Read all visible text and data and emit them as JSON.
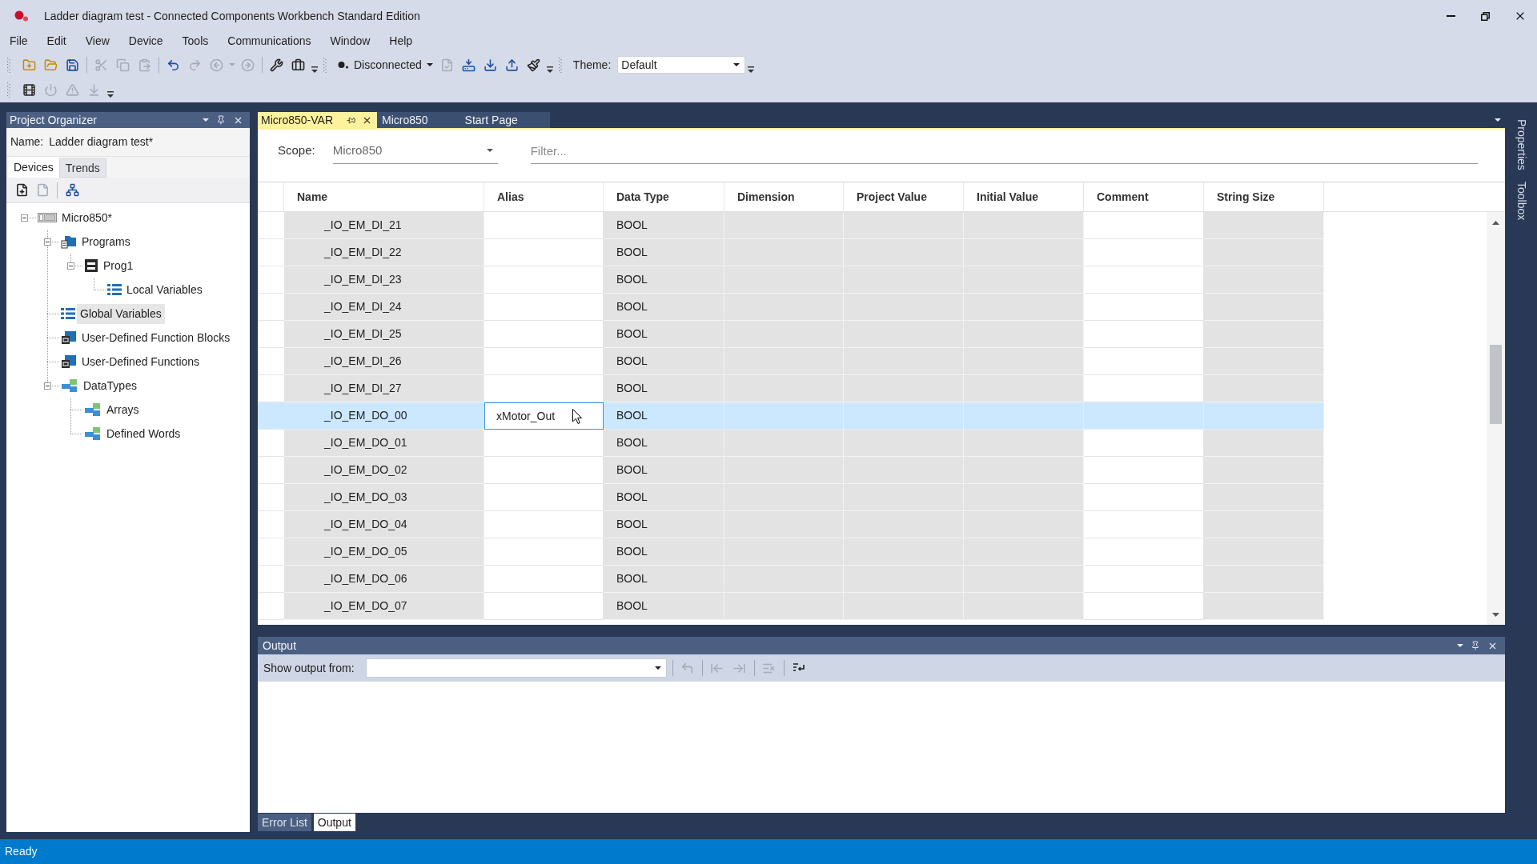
{
  "window": {
    "title": "Ladder diagram test - Connected Components Workbench Standard Edition"
  },
  "menu": [
    "File",
    "Edit",
    "View",
    "Device",
    "Tools",
    "Communications",
    "Window",
    "Help"
  ],
  "toolbar_rows": [
    {
      "groups": [
        {
          "items": [
            {
              "kind": "new",
              "disabled": false
            },
            {
              "kind": "open",
              "disabled": false
            },
            {
              "kind": "save",
              "disabled": false
            },
            {
              "kind": "separator"
            },
            {
              "kind": "cut",
              "disabled": true
            },
            {
              "kind": "copy",
              "disabled": true
            },
            {
              "kind": "paste",
              "disabled": true
            },
            {
              "kind": "separator"
            },
            {
              "kind": "undo",
              "disabled": false
            },
            {
              "kind": "redo",
              "disabled": true
            },
            {
              "kind": "back",
              "disabled": true
            },
            {
              "kind": "history_dropdown",
              "disabled": true
            },
            {
              "kind": "forward",
              "disabled": true
            },
            {
              "kind": "separator"
            },
            {
              "kind": "wrench",
              "disabled": false
            },
            {
              "kind": "toolbox",
              "disabled": false
            }
          ]
        },
        {
          "items": [
            {
              "kind": "connection",
              "label": "Disconnected",
              "disabled": false
            },
            {
              "kind": "check",
              "disabled": true
            },
            {
              "kind": "download_device",
              "disabled": false
            },
            {
              "kind": "download",
              "disabled": false
            },
            {
              "kind": "upload",
              "disabled": false
            },
            {
              "kind": "brush",
              "disabled": false
            }
          ]
        },
        {
          "items": [
            {
              "kind": "theme",
              "label": "Theme:",
              "value": "Default"
            }
          ]
        }
      ]
    },
    {
      "groups": [
        {
          "items": [
            {
              "kind": "run",
              "disabled": false
            },
            {
              "kind": "power",
              "disabled": true
            },
            {
              "kind": "warning",
              "disabled": true
            },
            {
              "kind": "import",
              "disabled": true
            }
          ]
        }
      ]
    }
  ],
  "project_organizer": {
    "title": "Project Organizer",
    "name_label": "Name:",
    "name_value": "Ladder diagram test*",
    "tabs": [
      {
        "label": "Devices",
        "selected": true
      },
      {
        "label": "Trends",
        "selected": false
      }
    ],
    "tools": [
      {
        "kind": "add_device",
        "disabled": false
      },
      {
        "kind": "remove_device",
        "disabled": true
      },
      {
        "kind": "separator"
      },
      {
        "kind": "tree_view",
        "disabled": false
      }
    ],
    "tree": [
      {
        "label": "Micro850*",
        "kind": "device",
        "expanded": true,
        "selected": false,
        "children": [
          {
            "label": "Programs",
            "kind": "folder",
            "expanded": true,
            "selected": false,
            "children": [
              {
                "label": "Prog1",
                "kind": "program",
                "expanded": true,
                "selected": false,
                "children": [
                  {
                    "label": "Local Variables",
                    "kind": "variables",
                    "selected": false
                  }
                ]
              }
            ]
          },
          {
            "label": "Global Variables",
            "kind": "variables",
            "selected": true
          },
          {
            "label": "User-Defined Function Blocks",
            "kind": "function_blocks",
            "selected": false
          },
          {
            "label": "User-Defined Functions",
            "kind": "functions",
            "selected": false
          },
          {
            "label": "DataTypes",
            "kind": "datatypes",
            "expanded": true,
            "selected": false,
            "children": [
              {
                "label": "Arrays",
                "kind": "datatypes",
                "selected": false
              },
              {
                "label": "Defined Words",
                "kind": "datatypes",
                "selected": false
              }
            ]
          }
        ]
      }
    ]
  },
  "document_tabs": [
    {
      "label": "Micro850-VAR",
      "selected": true
    },
    {
      "label": "Micro850",
      "selected": false
    },
    {
      "label": "Start Page",
      "selected": false
    }
  ],
  "variables_editor": {
    "scope_label": "Scope:",
    "scope_value": "Micro850",
    "filter": {
      "placeholder": "Filter..."
    },
    "columns": [
      {
        "label": "Name",
        "shaded": true
      },
      {
        "label": "Alias",
        "shaded": false
      },
      {
        "label": "Data Type",
        "shaded": true
      },
      {
        "label": "Dimension",
        "shaded": true
      },
      {
        "label": "Project Value",
        "shaded": true
      },
      {
        "label": "Initial Value",
        "shaded": true
      },
      {
        "label": "Comment",
        "shaded": false
      },
      {
        "label": "String Size",
        "shaded": true
      }
    ],
    "rows": [
      {
        "name": "_IO_EM_DI_21",
        "data_type": "BOOL",
        "selected": false
      },
      {
        "name": "_IO_EM_DI_22",
        "data_type": "BOOL",
        "selected": false
      },
      {
        "name": "_IO_EM_DI_23",
        "data_type": "BOOL",
        "selected": false
      },
      {
        "name": "_IO_EM_DI_24",
        "data_type": "BOOL",
        "selected": false
      },
      {
        "name": "_IO_EM_DI_25",
        "data_type": "BOOL",
        "selected": false
      },
      {
        "name": "_IO_EM_DI_26",
        "data_type": "BOOL",
        "selected": false
      },
      {
        "name": "_IO_EM_DI_27",
        "data_type": "BOOL",
        "selected": false
      },
      {
        "name": "_IO_EM_DO_00",
        "alias": "xMotor_Out",
        "data_type": "BOOL",
        "selected": true
      },
      {
        "name": "_IO_EM_DO_01",
        "data_type": "BOOL",
        "selected": false
      },
      {
        "name": "_IO_EM_DO_02",
        "data_type": "BOOL",
        "selected": false
      },
      {
        "name": "_IO_EM_DO_03",
        "data_type": "BOOL",
        "selected": false
      },
      {
        "name": "_IO_EM_DO_04",
        "data_type": "BOOL",
        "selected": false
      },
      {
        "name": "_IO_EM_DO_05",
        "data_type": "BOOL",
        "selected": false
      },
      {
        "name": "_IO_EM_DO_06",
        "data_type": "BOOL",
        "selected": false
      },
      {
        "name": "_IO_EM_DO_07",
        "data_type": "BOOL",
        "selected": false
      }
    ]
  },
  "output_panel": {
    "title": "Output",
    "source_label": "Show output from:",
    "tools": [
      {
        "kind": "separator"
      },
      {
        "kind": "go_to",
        "disabled": true
      },
      {
        "kind": "separator"
      },
      {
        "kind": "previous",
        "disabled": true
      },
      {
        "kind": "next",
        "disabled": true
      },
      {
        "kind": "separator"
      },
      {
        "kind": "clear",
        "disabled": true
      },
      {
        "kind": "separator"
      },
      {
        "kind": "word_wrap",
        "disabled": false
      }
    ]
  },
  "bottom_tabs": [
    {
      "label": "Error List",
      "selected": false
    },
    {
      "label": "Output",
      "selected": true
    }
  ],
  "side_tabs": [
    "Properties",
    "Toolbox"
  ],
  "status_bar": "Ready"
}
